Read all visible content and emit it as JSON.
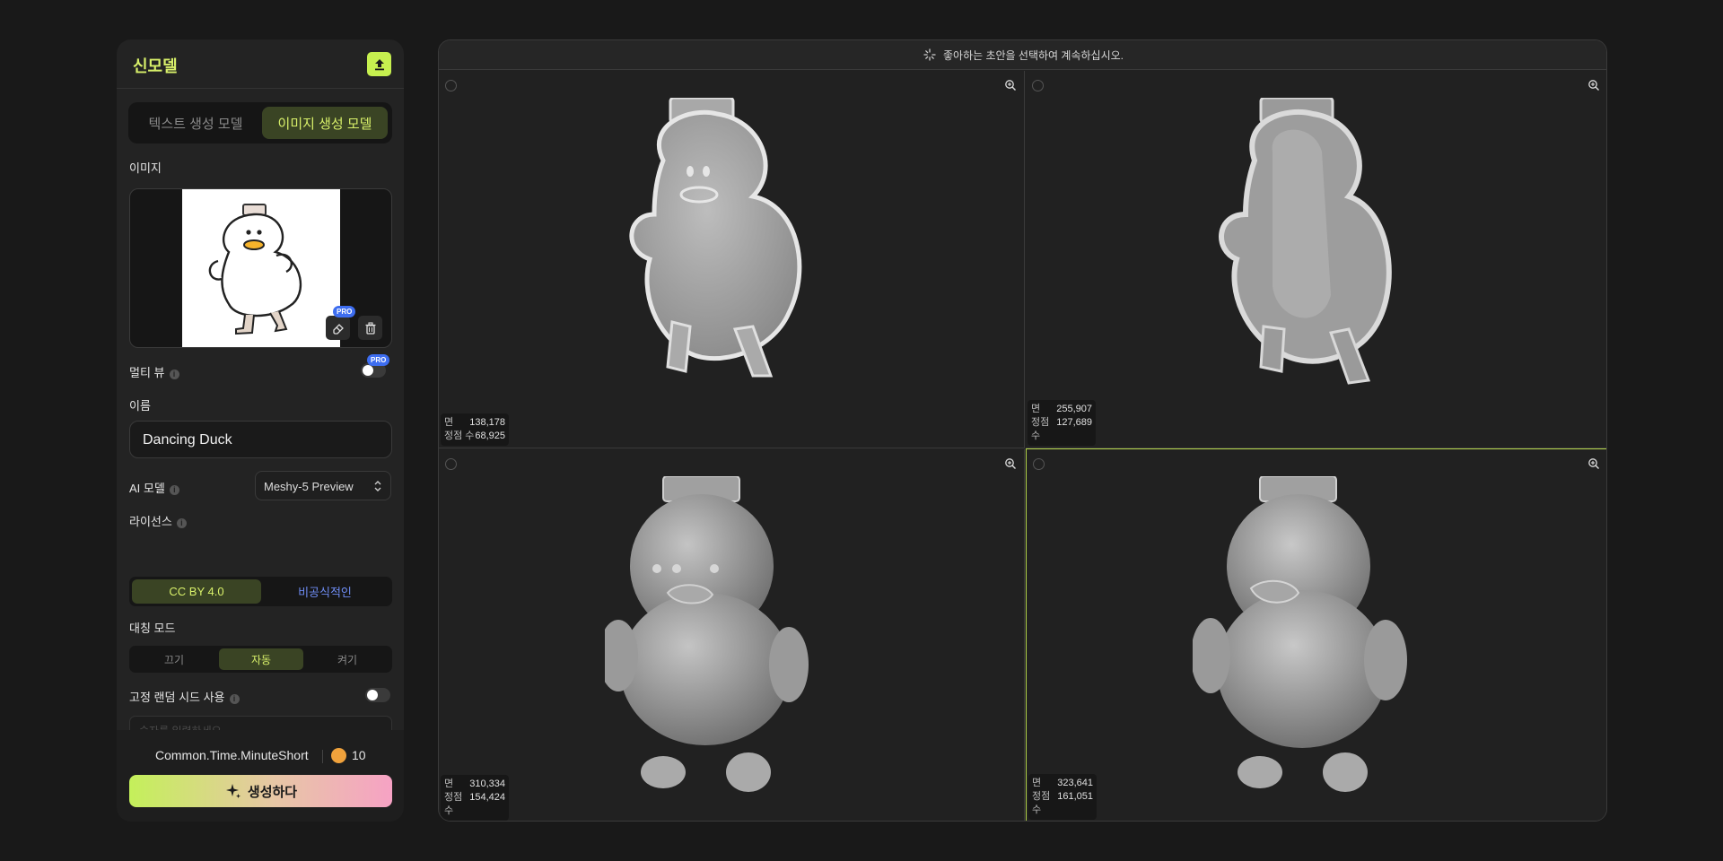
{
  "left_panel": {
    "title": "신모델",
    "upload_icon": "upload-icon",
    "mode_tabs": [
      "텍스트 생성 모델",
      "이미지 생성 모델"
    ],
    "active_mode": "이미지 생성 모델",
    "image_section_label": "이미지",
    "image_tool_icons": [
      "split-view-icon",
      "book-icon"
    ],
    "pro_badge": "PRO",
    "multiview_label": "멀티 뷰",
    "name_label": "이름",
    "name_value": "Dancing Duck",
    "ai_model_label": "AI 모델",
    "ai_model_value": "Meshy-5 Preview",
    "license_label": "라이선스",
    "license_options": [
      "CC BY 4.0",
      "비공식적인"
    ],
    "license_selected": "CC BY 4.0",
    "symmetry_label": "대칭 모드",
    "symmetry_options": [
      "끄기",
      "자동",
      "켜기"
    ],
    "symmetry_selected": "자동",
    "seed_label": "고정 랜덤 시드 사용",
    "seed_placeholder": "숫자를 입력하세요",
    "footer_time": "Common.Time.MinuteShort",
    "credits": "10",
    "generate_label": "생성하다",
    "accent": "#d8f06a"
  },
  "viewport": {
    "hint": "좋아하는 초안을 선택하여 계속하십시오.",
    "selected_index": 3,
    "selected_color": "#b5d64a",
    "drafts": [
      {
        "faces_label": "면",
        "faces": "138,178",
        "verts_label": "정점 수",
        "verts": "68,925"
      },
      {
        "faces_label": "면",
        "faces": "255,907",
        "verts_label": "정점 수",
        "verts": "127,689"
      },
      {
        "faces_label": "면",
        "faces": "310,334",
        "verts_label": "정점 수",
        "verts": "154,424"
      },
      {
        "faces_label": "면",
        "faces": "323,641",
        "verts_label": "정점 수",
        "verts": "161,051"
      }
    ]
  }
}
